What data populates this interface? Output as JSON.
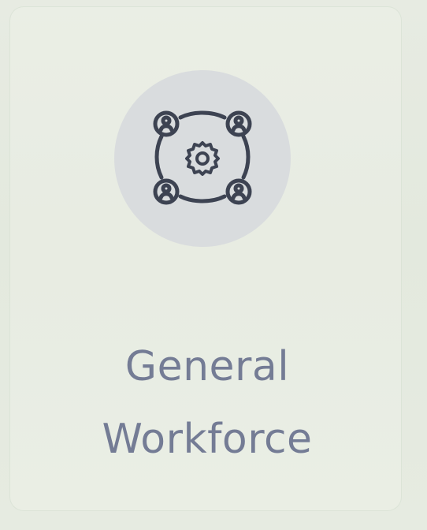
{
  "tile": {
    "label_line1": "General",
    "label_line2": "Workforce",
    "icon": "workforce-gear-people-icon",
    "colors": {
      "text": "#747c95",
      "icon_stroke": "#3d4352",
      "icon_circle": "#d9dcde",
      "background": "#e6ebe1"
    }
  }
}
